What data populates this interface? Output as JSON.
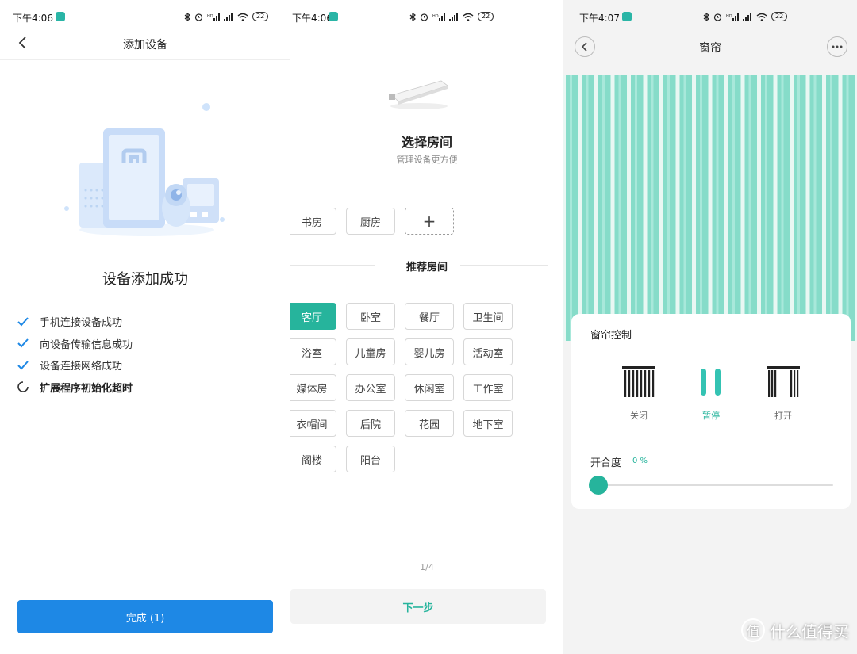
{
  "screen1": {
    "status": {
      "time": "下午4:06",
      "battery": "22"
    },
    "nav_title": "添加设备",
    "success_title": "设备添加成功",
    "steps": [
      {
        "label": "手机连接设备成功",
        "state": "done"
      },
      {
        "label": "向设备传输信息成功",
        "state": "done"
      },
      {
        "label": "设备连接网络成功",
        "state": "done"
      },
      {
        "label": "扩展程序初始化超时",
        "state": "loading"
      }
    ],
    "done_button": "完成 (1)"
  },
  "screen2": {
    "status": {
      "time": "下午4:06",
      "battery": "22"
    },
    "title": "选择房间",
    "subtitle": "管理设备更方便",
    "existing_rooms": [
      "书房",
      "厨房"
    ],
    "add_room_symbol": "+",
    "recommended_label": "推荐房间",
    "recommended_rooms": [
      "客厅",
      "卧室",
      "餐厅",
      "卫生间",
      "浴室",
      "儿童房",
      "婴儿房",
      "活动室",
      "媒体房",
      "办公室",
      "休闲室",
      "工作室",
      "衣帽间",
      "后院",
      "花园",
      "地下室",
      "阁楼",
      "阳台"
    ],
    "selected_room": "客厅",
    "pager": "1/4",
    "next_button": "下一步"
  },
  "screen3": {
    "status": {
      "time": "下午4:07",
      "battery": "22"
    },
    "title": "窗帘",
    "card_title": "窗帘控制",
    "controls": [
      {
        "label": "关闭",
        "icon": "curtain-closed-icon",
        "active": false
      },
      {
        "label": "暂停",
        "icon": "pause-icon",
        "active": true
      },
      {
        "label": "打开",
        "icon": "curtain-open-icon",
        "active": false
      }
    ],
    "open_label": "开合度",
    "open_value": "0 %",
    "open_fraction": 0
  },
  "watermark": {
    "text": "什么值得买",
    "logo_char": "值"
  },
  "colors": {
    "accent": "#26b49c",
    "primary_blue": "#1e88e5",
    "curtain": "#86dcc9"
  }
}
